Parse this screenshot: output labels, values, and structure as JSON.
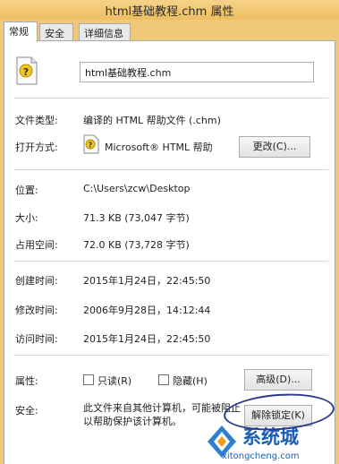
{
  "window": {
    "title": "html基础教程.chm 属性"
  },
  "tabs": [
    {
      "label": "常规"
    },
    {
      "label": "安全"
    },
    {
      "label": "详细信息"
    }
  ],
  "file": {
    "name": "html基础教程.chm"
  },
  "details": {
    "type_label": "文件类型:",
    "type_value": "编译的 HTML 帮助文件 (.chm)",
    "open_label": "打开方式:",
    "open_value": "Microsoft® HTML 帮助",
    "change_button": "更改(C)...",
    "location_label": "位置:",
    "location_value": "C:\\Users\\zcw\\Desktop",
    "size_label": "大小:",
    "size_value": "71.3 KB (73,047 字节)",
    "disk_label": "占用空间:",
    "disk_value": "72.0 KB (73,728 字节)",
    "created_label": "创建时间:",
    "created_value": "2015年1月24日，22:45:50",
    "modified_label": "修改时间:",
    "modified_value": "2006年9月28日，14:12:44",
    "accessed_label": "访问时间:",
    "accessed_value": "2015年1月24日，22:45:50",
    "attributes_label": "属性:",
    "readonly_label": "只读(R)",
    "hidden_label": "隐藏(H)",
    "advanced_button": "高级(D)...",
    "security_label": "安全:",
    "security_text_1": "此文件来自其他计算机，可能被阻止",
    "security_text_2": "以帮助保护该计算机。",
    "unblock_button": "解除锁定(K)"
  },
  "watermark": {
    "brand": "系统城",
    "url": "xitongcheng.com"
  },
  "colors": {
    "titlebar": "#eebe62",
    "annotation": "#2a3a8f",
    "watermark": "#1a5fb4"
  }
}
